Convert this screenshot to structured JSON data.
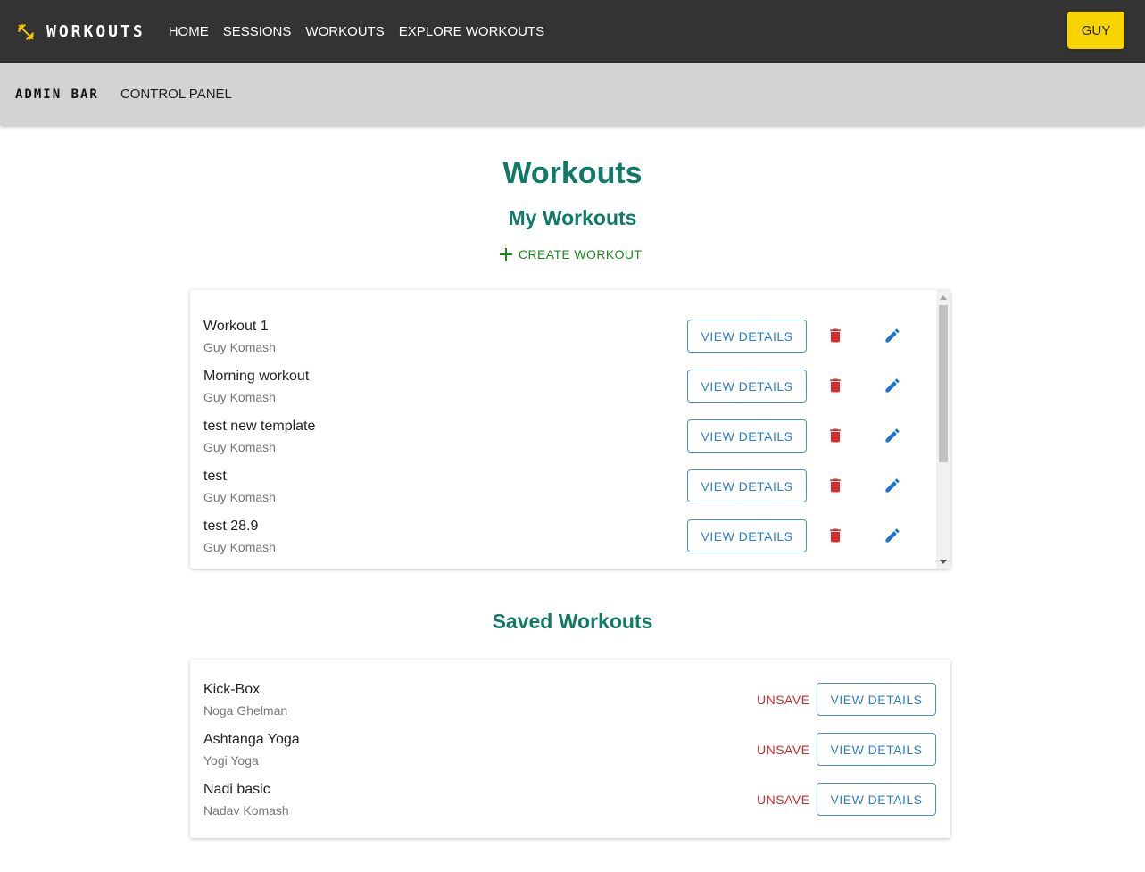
{
  "appbar": {
    "brand_title": "WORKOUTS",
    "brand_icon": "dumbbell-icon",
    "nav": [
      {
        "label": "HOME"
      },
      {
        "label": "SESSIONS"
      },
      {
        "label": "WORKOUTS"
      },
      {
        "label": "EXPLORE WORKOUTS"
      }
    ],
    "user_label": "GUY",
    "accent_color": "#f5d400"
  },
  "adminbar": {
    "title": "ADMIN BAR",
    "link": "CONTROL PANEL"
  },
  "page": {
    "title": "Workouts",
    "my_workouts_heading": "My Workouts",
    "create_label": "CREATE WORKOUT",
    "saved_heading": "Saved Workouts",
    "heading_color": "#0f7a66"
  },
  "my_workouts": [
    {
      "title": "Workout 1",
      "author": "Guy Komash",
      "view_label": "VIEW DETAILS"
    },
    {
      "title": "Morning workout",
      "author": "Guy Komash",
      "view_label": "VIEW DETAILS"
    },
    {
      "title": "test new template",
      "author": "Guy Komash",
      "view_label": "VIEW DETAILS"
    },
    {
      "title": "test",
      "author": "Guy Komash",
      "view_label": "VIEW DETAILS"
    },
    {
      "title": "test 28.9",
      "author": "Guy Komash",
      "view_label": "VIEW DETAILS"
    }
  ],
  "saved_workouts": [
    {
      "title": "Kick-Box",
      "author": "Noga Ghelman",
      "unsave_label": "UNSAVE",
      "view_label": "VIEW DETAILS"
    },
    {
      "title": "Ashtanga Yoga",
      "author": "Yogi Yoga",
      "unsave_label": "UNSAVE",
      "view_label": "VIEW DETAILS"
    },
    {
      "title": "Nadi basic",
      "author": "Nadav Komash",
      "unsave_label": "UNSAVE",
      "view_label": "VIEW DETAILS"
    }
  ],
  "colors": {
    "delete": "#d32f2f",
    "edit": "#1976d2",
    "create": "#1b8a1b"
  }
}
